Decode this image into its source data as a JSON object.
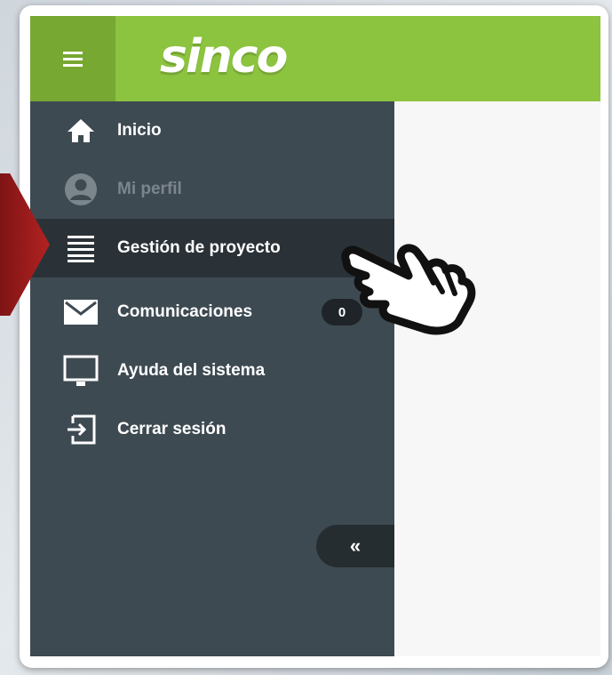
{
  "app": {
    "logo_text": "sinco"
  },
  "header": {
    "menu_icon": "hamburger-icon"
  },
  "sidebar": {
    "items": [
      {
        "label": "Inicio",
        "icon": "home-icon"
      },
      {
        "label": "Mi perfil",
        "icon": "user-icon",
        "disabled": true
      },
      {
        "label": "Gestión de proyecto",
        "icon": "list-icon",
        "active": true
      },
      {
        "label": "Comunicaciones",
        "icon": "mail-icon",
        "badge": "0"
      },
      {
        "label": "Ayuda del sistema",
        "icon": "monitor-icon"
      },
      {
        "label": "Cerrar sesión",
        "icon": "logout-icon"
      }
    ],
    "collapse_label": "«"
  },
  "colors": {
    "brand_green": "#8cc33f",
    "sidebar_bg": "#3e4a52",
    "active_bg": "#2a3237",
    "pointer_arrow": "#b32222"
  }
}
